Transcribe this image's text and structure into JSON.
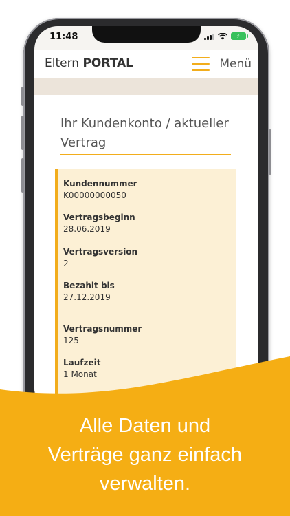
{
  "status_bar": {
    "time": "11:48"
  },
  "header": {
    "logo_prefix": "Eltern",
    "logo_bold": "PORTAL",
    "menu_label": "Menü"
  },
  "main": {
    "title": "Ihr Kundenkonto / aktueller Vertrag",
    "fields": [
      {
        "label": "Kundennummer",
        "value": "K00000000050"
      },
      {
        "label": "Vertragsbeginn",
        "value": "28.06.2019"
      },
      {
        "label": "Vertragsversion",
        "value": "2"
      },
      {
        "label": "Bezahlt bis",
        "value": "27.12.2019"
      },
      {
        "label": "Vertragsnummer",
        "value": "125"
      },
      {
        "label": "Laufzeit",
        "value": "1 Monat"
      }
    ]
  },
  "promo": {
    "line1": "Alle Daten und",
    "line2": "Verträge ganz einfach",
    "line3": "verwalten."
  },
  "colors": {
    "accent": "#f2ad1c",
    "card_background": "#fcf0d5",
    "band": "#ece4da",
    "battery": "#37c15b"
  }
}
